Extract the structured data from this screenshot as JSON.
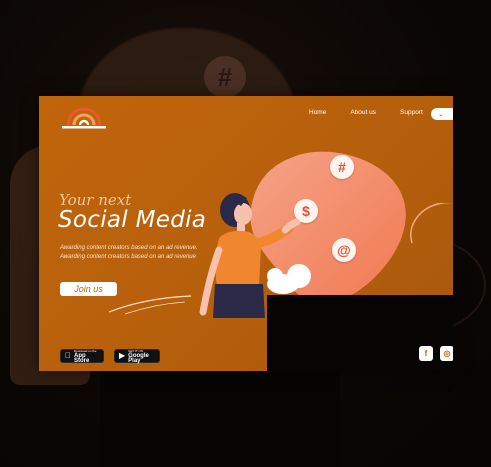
{
  "nav": {
    "items": [
      {
        "label": "Home"
      },
      {
        "label": "About us"
      },
      {
        "label": "Support"
      }
    ]
  },
  "hero": {
    "subtitle": "Your next",
    "title": "Social Media",
    "description": "Awarding content creators based on an ad revenue. Awarding content creators based on an ad revenue",
    "cta_label": "Join us"
  },
  "badges": {
    "appstore_small": "Download on the",
    "appstore_big": "App Store",
    "googleplay_small": "GET IT ON",
    "googleplay_big": "Google Play"
  },
  "bubbles": {
    "hash": "#",
    "dollar": "$",
    "at": "@"
  },
  "social": {
    "facebook_icon": "f",
    "instagram_icon": "◎"
  },
  "colors": {
    "accent": "#c0650b",
    "bubble_text": "#e2533c",
    "blob": "#f48a6a"
  }
}
